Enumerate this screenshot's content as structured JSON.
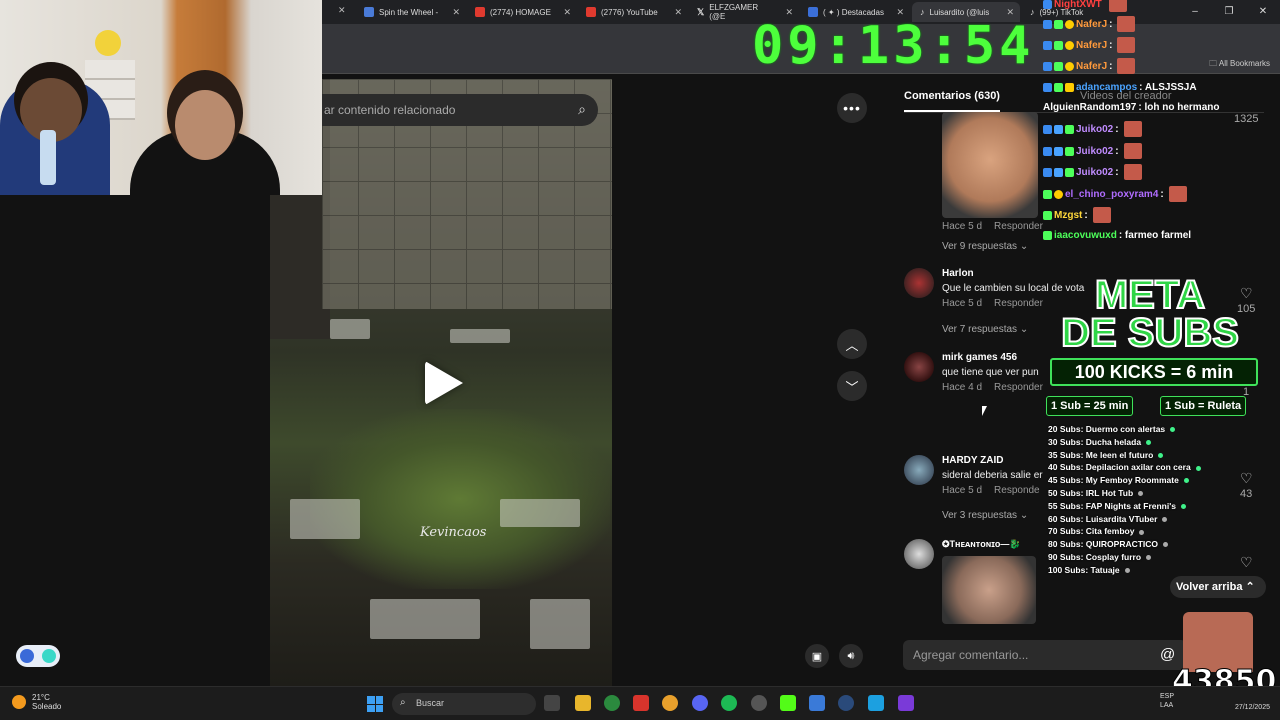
{
  "browser": {
    "tabs": [
      {
        "label": "Spin the Wheel -",
        "color": "#4a7bd8"
      },
      {
        "label": "(2774) HOMAGE",
        "color": "#e03a2f"
      },
      {
        "label": "(2776) YouTube",
        "color": "#e03a2f"
      },
      {
        "label": "ELFZGAMER (@E",
        "color": "#000000"
      },
      {
        "label": "( ✦ ) Destacadas",
        "color": "#3b6fd8"
      },
      {
        "label": "Luisardito (@luis",
        "color": "#111111"
      },
      {
        "label": "(99+) TikTok",
        "color": "#111111"
      }
    ],
    "all_bookmarks": "All Bookmarks"
  },
  "clock": "09:13:54",
  "feed": {
    "search_placeholder": "ar contenido relacionado",
    "video_watermark": "Kevincaos"
  },
  "comments": {
    "tabs": [
      "Comentarios (630)",
      "Videos del creador"
    ],
    "top_like_count": "1325",
    "items": [
      {
        "user": "",
        "text": "",
        "time": "Hace 5 d",
        "reply": "Responder",
        "replies": "Ver 9 respuestas",
        "likes": ""
      },
      {
        "user": "Harlon",
        "text": "Que le cambien su local de vota",
        "time": "Hace 5 d",
        "reply": "Responder",
        "replies": "Ver 7 respuestas",
        "likes": "105"
      },
      {
        "user": "mirk games 456",
        "text": "que tiene que ver pun",
        "time": "Hace 4 d",
        "reply": "Responder",
        "replies": "",
        "likes": "1"
      },
      {
        "user": "HARDY ZAID",
        "text": "sideral deberia salie er",
        "time": "Hace 5 d",
        "reply": "Responde",
        "replies": "Ver 3 respuestas",
        "likes": "43"
      },
      {
        "user": "✪Tʜᴇᴀɴᴛᴏɴɪᴏ—🐉",
        "text": "",
        "time": "",
        "reply": "",
        "replies": "",
        "likes": ""
      }
    ],
    "add_placeholder": "Agregar comentario...",
    "back_to_top": "Volver arriba"
  },
  "chat": [
    {
      "user": "NightXWT",
      "msg": "",
      "color": "#ff4040"
    },
    {
      "user": "NaferJ",
      "msg": "",
      "color": "#ff9a3c"
    },
    {
      "user": "NaferJ",
      "msg": "",
      "color": "#ff9a3c"
    },
    {
      "user": "NaferJ",
      "msg": "",
      "color": "#ff9a3c"
    },
    {
      "user": "adancampos",
      "msg": ": ALSJSSJA",
      "color": "#4aa3ff"
    },
    {
      "user": "AlguienRandom197",
      "msg": ": loh no hermano",
      "color": "#ffffff"
    },
    {
      "user": "Juiko02",
      "msg": "",
      "color": "#c08cff"
    },
    {
      "user": "Juiko02",
      "msg": "",
      "color": "#c08cff"
    },
    {
      "user": "Juiko02",
      "msg": "",
      "color": "#c08cff"
    },
    {
      "user": "el_chino_poxyram4",
      "msg": "",
      "color": "#b06cff"
    },
    {
      "user": "Mzgst",
      "msg": "",
      "color": "#ffd83a"
    },
    {
      "user": "iaacovuwuxd",
      "msg": ": farmeo farmel",
      "color": "#4dff5a"
    }
  ],
  "subs_goal": {
    "title_line1": "META",
    "title_line2": "DE SUBS",
    "banner": "100 KICKS = 6 min",
    "left_rule": "1 Sub = 25 min",
    "right_rule": "1 Sub = Ruleta",
    "list": [
      "20 Subs: Duermo con alertas",
      "30 Subs: Ducha helada",
      "35 Subs: Me leen el futuro",
      "40 Subs: Depilacion axilar con cera",
      "45 Subs: My Femboy Roommate",
      "50 Subs: IRL Hot Tub",
      "55 Subs: FAP Nights at Frenni's",
      "60 Subs: Luisardita VTuber",
      "70 Subs: Cita femboy",
      "80 Subs: QUIROPRACTICO",
      "90 Subs: Cosplay furro",
      "100 Subs: Tatuaje"
    ],
    "count": "43850"
  },
  "taskbar": {
    "temp": "21°C",
    "weather": "Soleado",
    "search": "Buscar",
    "lang": "ESP",
    "lang2": "LAA",
    "date": "27/12/2025"
  },
  "colors": {
    "clock": "#4dff3c",
    "accent_green": "#2fd646"
  }
}
